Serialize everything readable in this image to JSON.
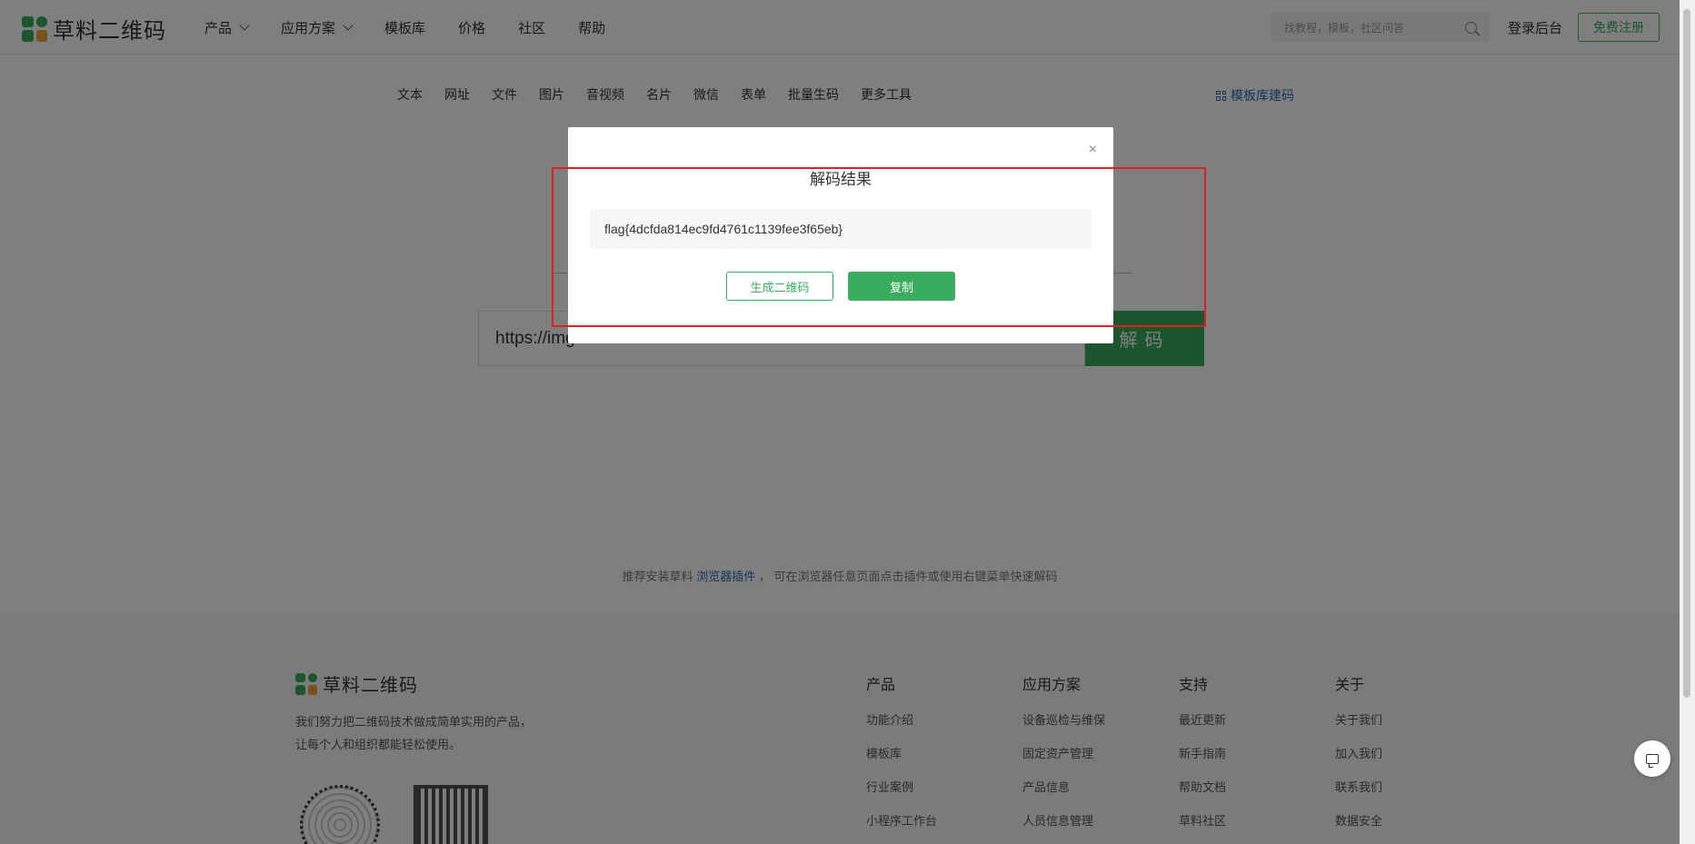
{
  "header": {
    "logo_text": "草料二维码",
    "nav": [
      {
        "label": "产品",
        "dropdown": true
      },
      {
        "label": "应用方案",
        "dropdown": true
      },
      {
        "label": "模板库",
        "dropdown": false
      },
      {
        "label": "价格",
        "dropdown": false
      },
      {
        "label": "社区",
        "dropdown": false
      },
      {
        "label": "帮助",
        "dropdown": false
      }
    ],
    "search_placeholder": "找教程，模板，社区问答",
    "login_label": "登录后台",
    "register_label": "免费注册"
  },
  "main": {
    "tabs": [
      "文本",
      "网址",
      "文件",
      "图片",
      "音视频",
      "名片",
      "微信",
      "表单",
      "批量生码",
      "更多工具"
    ],
    "template_link": "模板库建码",
    "url_value": "https://img",
    "decode_button": "解码",
    "tip_prefix": "推荐安装草料",
    "tip_link": "浏览器插件",
    "tip_suffix": "， 可在浏览器任意页面点击插件或使用右键菜单快速解码"
  },
  "modal": {
    "title": "解码结果",
    "close_icon": "×",
    "result": "flag{4dcfda814ec9fd4761c1139fee3f65eb}",
    "generate_button": "生成二维码",
    "copy_button": "复制"
  },
  "footer": {
    "logo_text": "草料二维码",
    "desc_line1": "我们努力把二维码技术做成简单实用的产品，",
    "desc_line2": "让每个人和组织都能轻松使用。",
    "columns": [
      {
        "title": "产品",
        "links": [
          "功能介绍",
          "模板库",
          "行业案例",
          "小程序工作台"
        ]
      },
      {
        "title": "应用方案",
        "links": [
          "设备巡检与维保",
          "固定资产管理",
          "产品信息",
          "人员信息管理"
        ]
      },
      {
        "title": "支持",
        "links": [
          "最近更新",
          "新手指南",
          "帮助文档",
          "草料社区"
        ]
      },
      {
        "title": "关于",
        "links": [
          "关于我们",
          "加入我们",
          "联系我们",
          "数据安全"
        ]
      }
    ]
  },
  "colors": {
    "brand_green": "#3aac5d",
    "link_blue": "#2b6ab8",
    "highlight_red": "#e02020"
  }
}
